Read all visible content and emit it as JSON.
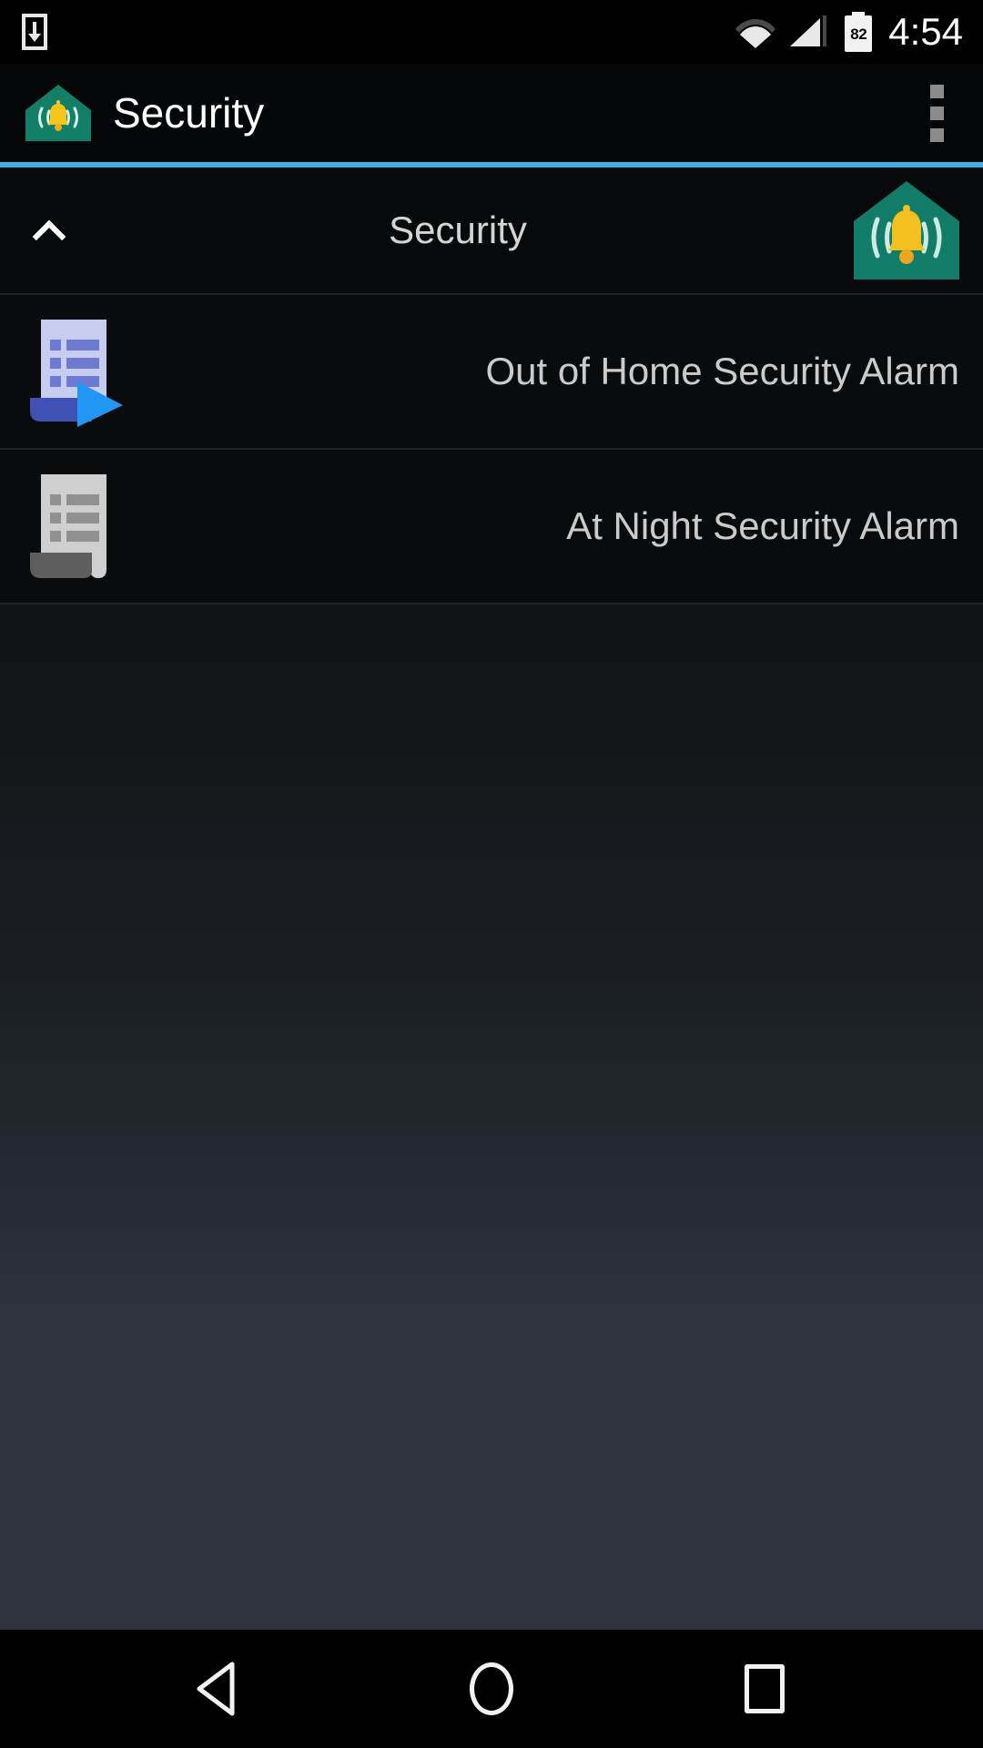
{
  "status_bar": {
    "left_icon": "download-icon",
    "wifi_icon": "wifi-icon",
    "signal_icon": "cellular-signal-icon",
    "battery_level": "82",
    "time": "4:54"
  },
  "app_bar": {
    "icon": "home-alarm-icon",
    "title": "Security",
    "overflow_label": "more-options"
  },
  "accent_color": "#3fabe3",
  "group": {
    "collapse_icon": "chevron-up-icon",
    "title": "Security",
    "icon": "home-alarm-icon"
  },
  "list": {
    "items": [
      {
        "icon": "playable-macro-document-icon",
        "label": "Out of Home Security Alarm"
      },
      {
        "icon": "macro-document-icon",
        "label": "At Night Security Alarm"
      }
    ]
  },
  "nav_bar": {
    "back": "back-triangle-icon",
    "home": "home-circle-icon",
    "recents": "recents-square-icon"
  }
}
